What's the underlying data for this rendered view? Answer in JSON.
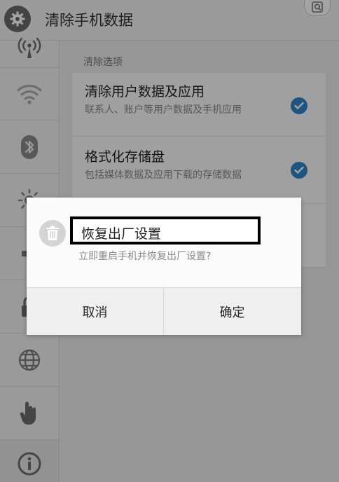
{
  "header": {
    "title": "清除手机数据",
    "settings_icon": "gear-icon",
    "search_icon": "search-icon"
  },
  "sidebar": {
    "items": [
      {
        "icon": "antenna-icon"
      },
      {
        "icon": "wifi-icon"
      },
      {
        "icon": "bluetooth-icon"
      },
      {
        "icon": "brightness-icon"
      },
      {
        "icon": "volume-icon"
      },
      {
        "icon": "lock-icon"
      },
      {
        "icon": "globe-icon"
      },
      {
        "icon": "hand-icon"
      },
      {
        "icon": "info-icon"
      }
    ]
  },
  "clear_options": {
    "section_label": "清除选项",
    "options": [
      {
        "title": "清除用户数据及应用",
        "desc": "联系人、账户等用户数据及手机应用",
        "checked": true
      },
      {
        "title": "格式化存储盘",
        "desc": "包括媒体数据及应用下载的存储数据",
        "checked": true
      }
    ]
  },
  "dialog": {
    "icon": "trash-icon",
    "title": "恢复出厂设置",
    "message": "立即重启手机并恢复出厂设置?",
    "cancel_label": "取消",
    "confirm_label": "确定"
  },
  "colors": {
    "accent": "#2d86c7",
    "highlight_border": "#000000"
  }
}
